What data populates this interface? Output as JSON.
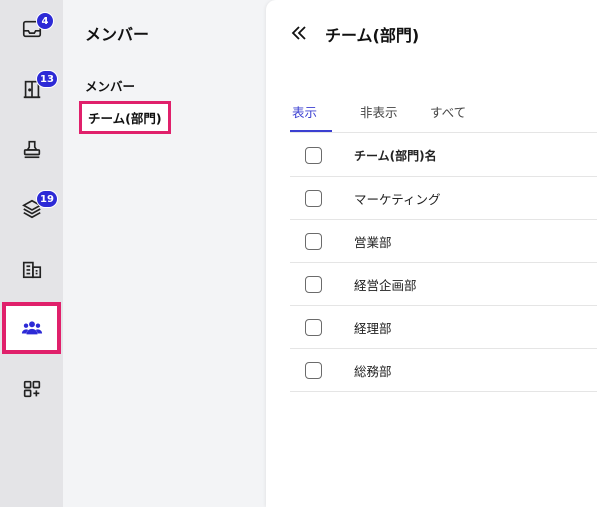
{
  "rail": {
    "items": [
      {
        "name": "inbox-icon",
        "badge": "4"
      },
      {
        "name": "door-icon",
        "badge": "13"
      },
      {
        "name": "stamp-icon",
        "badge": ""
      },
      {
        "name": "layers-icon",
        "badge": "19"
      },
      {
        "name": "building-icon",
        "badge": ""
      },
      {
        "name": "team-icon",
        "badge": "",
        "active": true
      },
      {
        "name": "add-app-icon",
        "badge": ""
      }
    ],
    "accent": "#2d2ad6",
    "highlight": "#e0206b"
  },
  "subnav": {
    "title": "メンバー",
    "items": [
      {
        "label": "メンバー"
      },
      {
        "label": "チーム(部門)",
        "active": true
      }
    ]
  },
  "main": {
    "title": "チーム(部門)",
    "tabs": [
      {
        "label": "表示",
        "active": true
      },
      {
        "label": "非表示"
      },
      {
        "label": "すべて"
      }
    ],
    "table": {
      "header": "チーム(部門)名",
      "rows": [
        "マーケティング",
        "営業部",
        "経営企画部",
        "経理部",
        "総務部"
      ]
    }
  }
}
